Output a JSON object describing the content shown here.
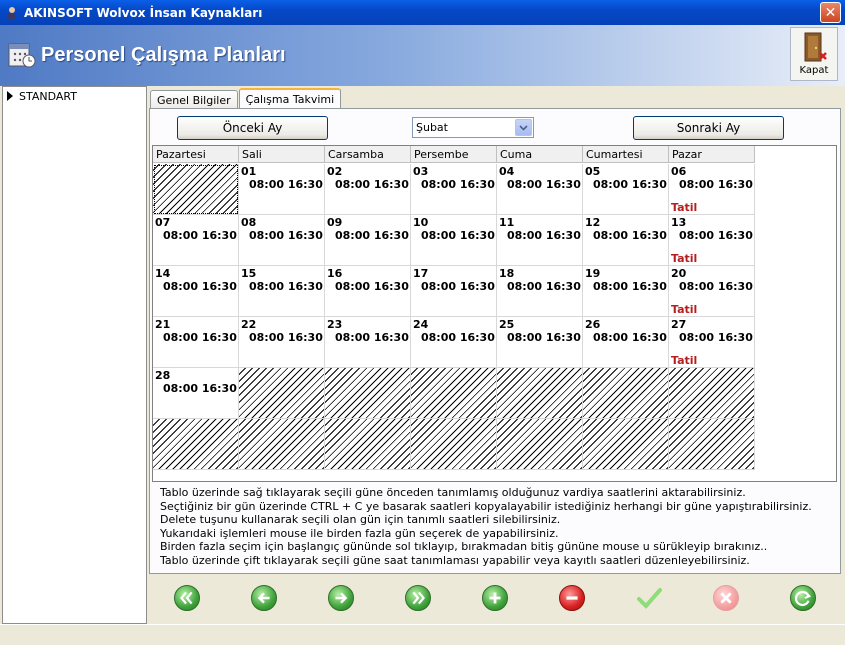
{
  "window": {
    "title": "AKINSOFT Wolvox İnsan Kaynakları",
    "close_symbol": "✕"
  },
  "header": {
    "title": "Personel Çalışma Planları",
    "close_label": "Kapat"
  },
  "sidebar": {
    "items": [
      {
        "label": "STANDART"
      }
    ]
  },
  "tabs": [
    {
      "label": "Genel Bilgiler"
    },
    {
      "label": "Çalışma Takvimi"
    }
  ],
  "active_tab": "Çalışma Takvimi",
  "nav": {
    "prev_label": "Önceki Ay",
    "next_label": "Sonraki Ay",
    "month_value": "Şubat"
  },
  "calendar": {
    "weekdays": [
      "Pazartesi",
      "Sali",
      "Carsamba",
      "Persembe",
      "Cuma",
      "Cumartesi",
      "Pazar"
    ],
    "hours": "08:00 16:30",
    "holiday_label": "Tatil",
    "days": [
      {
        "day": "01",
        "hours": "08:00 16:30",
        "tatil": ""
      },
      {
        "day": "02",
        "hours": "08:00 16:30",
        "tatil": ""
      },
      {
        "day": "03",
        "hours": "08:00 16:30",
        "tatil": ""
      },
      {
        "day": "04",
        "hours": "08:00 16:30",
        "tatil": ""
      },
      {
        "day": "05",
        "hours": "08:00 16:30",
        "tatil": ""
      },
      {
        "day": "06",
        "hours": "08:00 16:30",
        "tatil": "Tatil"
      },
      {
        "day": "07",
        "hours": "08:00 16:30",
        "tatil": ""
      },
      {
        "day": "08",
        "hours": "08:00 16:30",
        "tatil": ""
      },
      {
        "day": "09",
        "hours": "08:00 16:30",
        "tatil": ""
      },
      {
        "day": "10",
        "hours": "08:00 16:30",
        "tatil": ""
      },
      {
        "day": "11",
        "hours": "08:00 16:30",
        "tatil": ""
      },
      {
        "day": "12",
        "hours": "08:00 16:30",
        "tatil": ""
      },
      {
        "day": "13",
        "hours": "08:00 16:30",
        "tatil": "Tatil"
      },
      {
        "day": "14",
        "hours": "08:00 16:30",
        "tatil": ""
      },
      {
        "day": "15",
        "hours": "08:00 16:30",
        "tatil": ""
      },
      {
        "day": "16",
        "hours": "08:00 16:30",
        "tatil": ""
      },
      {
        "day": "17",
        "hours": "08:00 16:30",
        "tatil": ""
      },
      {
        "day": "18",
        "hours": "08:00 16:30",
        "tatil": ""
      },
      {
        "day": "19",
        "hours": "08:00 16:30",
        "tatil": ""
      },
      {
        "day": "20",
        "hours": "08:00 16:30",
        "tatil": "Tatil"
      },
      {
        "day": "21",
        "hours": "08:00 16:30",
        "tatil": ""
      },
      {
        "day": "22",
        "hours": "08:00 16:30",
        "tatil": ""
      },
      {
        "day": "23",
        "hours": "08:00 16:30",
        "tatil": ""
      },
      {
        "day": "24",
        "hours": "08:00 16:30",
        "tatil": ""
      },
      {
        "day": "25",
        "hours": "08:00 16:30",
        "tatil": ""
      },
      {
        "day": "26",
        "hours": "08:00 16:30",
        "tatil": ""
      },
      {
        "day": "27",
        "hours": "08:00 16:30",
        "tatil": "Tatil"
      },
      {
        "day": "28",
        "hours": "08:00 16:30",
        "tatil": ""
      }
    ]
  },
  "info_lines": [
    "Tablo üzerinde sağ tıklayarak seçili güne önceden tanımlamış olduğunuz vardiya saatlerini aktarabilirsiniz.",
    "Seçtiğiniz bir gün üzerinde CTRL + C ye basarak saatleri kopyalayabilir istediğiniz herhangi bir güne yapıştırabilirsiniz.",
    "Delete tuşunu kullanarak seçili olan gün için tanımlı saatleri silebilirsiniz.",
    "Yukarıdaki işlemleri mouse ile birden fazla gün seçerek de yapabilirsiniz.",
    "Birden fazla seçim için başlangıç gününde sol tıklayıp, bırakmadan bitiş gününe mouse u sürükleyip bırakınız..",
    "Tablo üzerinde çift tıklayarak seçili güne saat tanımlaması yapabilir veya kayıtlı saatleri düzenleyebilirsiniz."
  ],
  "toolbar": {
    "buttons": [
      {
        "name": "first-record-button",
        "icon": "double-left-arrow-icon",
        "color": "#3fa23a"
      },
      {
        "name": "previous-record-button",
        "icon": "left-arrow-icon",
        "color": "#3fa23a"
      },
      {
        "name": "next-record-button",
        "icon": "right-arrow-icon",
        "color": "#3fa23a"
      },
      {
        "name": "last-record-button",
        "icon": "double-right-arrow-icon",
        "color": "#3fa23a"
      },
      {
        "name": "add-button",
        "icon": "plus-icon",
        "color": "#3fa23a"
      },
      {
        "name": "delete-button",
        "icon": "minus-icon",
        "color": "#d62020"
      },
      {
        "name": "save-button",
        "icon": "check-icon",
        "color": "#8edc7a"
      },
      {
        "name": "cancel-button",
        "icon": "x-icon",
        "color": "#f4a0a0"
      },
      {
        "name": "refresh-button",
        "icon": "refresh-icon",
        "color": "#3fa23a"
      }
    ]
  }
}
